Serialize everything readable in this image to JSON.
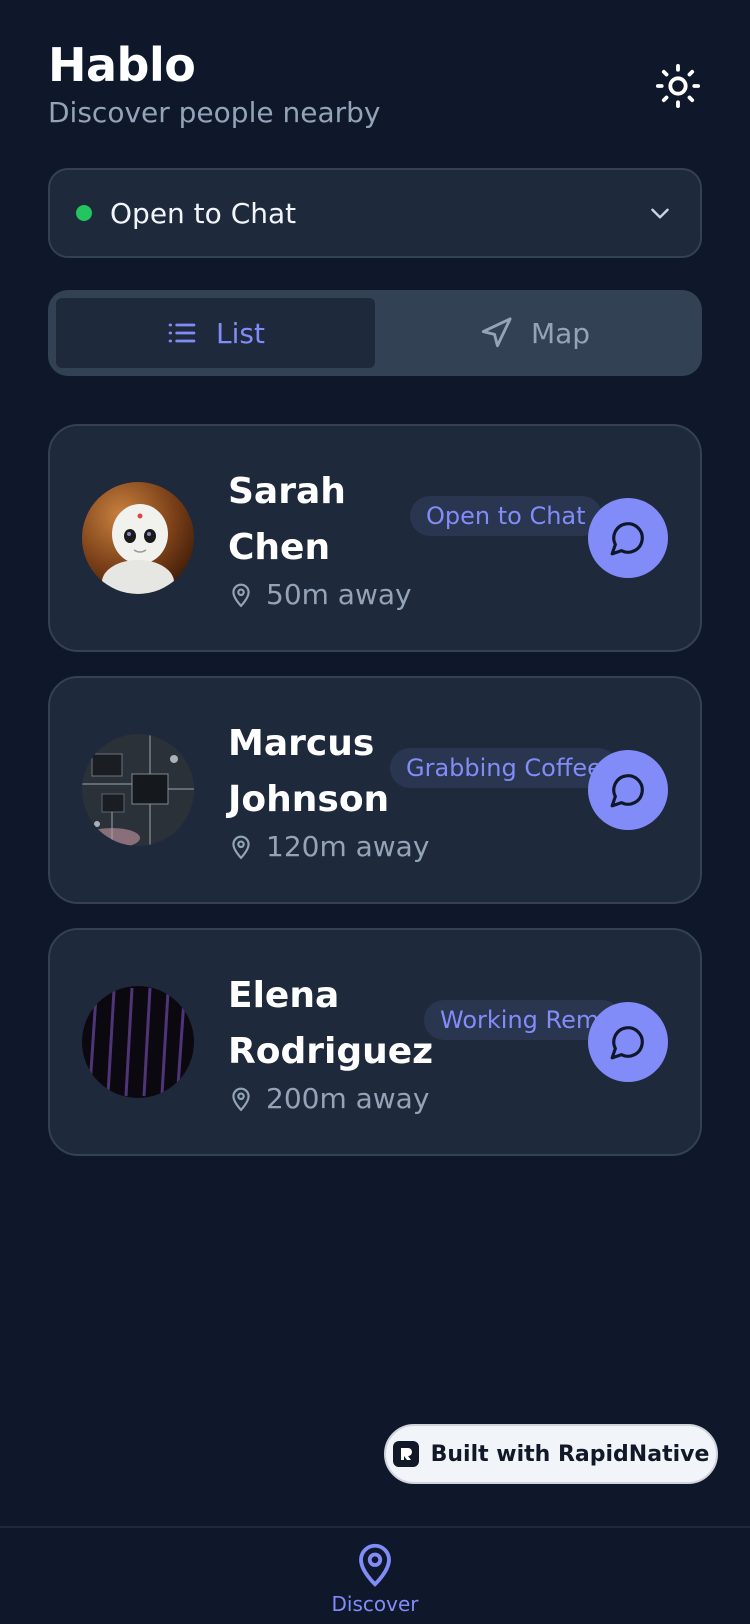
{
  "app": {
    "title": "Hablo",
    "subtitle": "Discover people nearby"
  },
  "status_select": {
    "value": "Open to Chat",
    "dot_color": "#22c55e"
  },
  "view_toggle": {
    "list_label": "List",
    "map_label": "Map",
    "active": "List"
  },
  "people": [
    {
      "name_first": "Sarah",
      "name_last": "Chen",
      "status": "Open to Chat",
      "distance": "50m away",
      "avatar": "robot"
    },
    {
      "name_first": "Marcus",
      "name_last": "Johnson",
      "status": "Grabbing Coffee",
      "distance": "120m away",
      "avatar": "circuit-board"
    },
    {
      "name_first": "Elena",
      "name_last": "Rodriguez",
      "status": "Working Remo",
      "distance": "200m away",
      "avatar": "dark-lines"
    }
  ],
  "built_with": {
    "label": "Built with RapidNative"
  },
  "tabbar": {
    "discover_label": "Discover"
  },
  "colors": {
    "background": "#0f172a",
    "card": "#1e293b",
    "accent": "#818cf8",
    "muted": "#94a3b8"
  }
}
